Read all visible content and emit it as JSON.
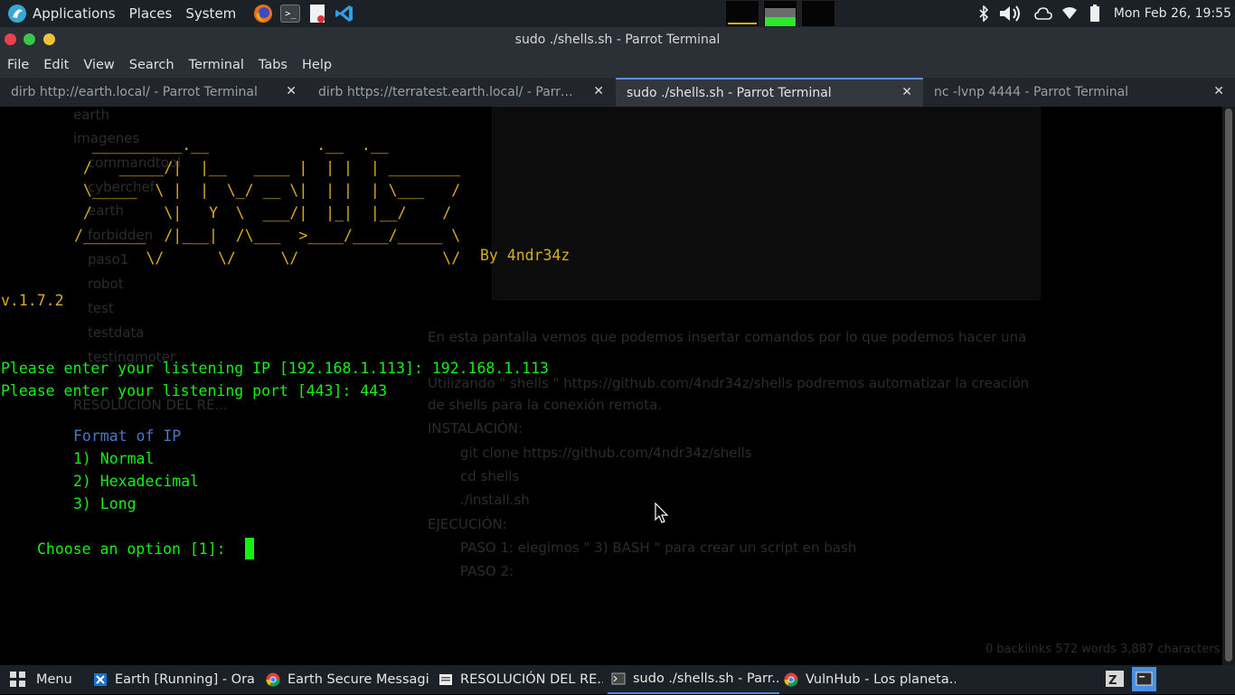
{
  "top_panel": {
    "menus": [
      "Applications",
      "Places",
      "System"
    ],
    "clock": "Mon Feb 26, 19:55",
    "launchers": [
      "firefox-icon",
      "terminal-icon",
      "text-editor-icon",
      "vscode-icon"
    ],
    "tray_icons": [
      "bluetooth-icon",
      "volume-icon",
      "cloud-icon",
      "wifi-icon",
      "battery-icon"
    ]
  },
  "window": {
    "title": "sudo ./shells.sh - Parrot Terminal",
    "menus": [
      "File",
      "Edit",
      "View",
      "Search",
      "Terminal",
      "Tabs",
      "Help"
    ]
  },
  "tabs": [
    {
      "label": "dirb http://earth.local/ - Parrot Terminal",
      "active": false
    },
    {
      "label": "dirb https://terratest.earth.local/ - Parrot Terminal",
      "active": false
    },
    {
      "label": "sudo ./shells.sh - Parrot Terminal",
      "active": true
    },
    {
      "label": "nc -lvnp 4444 - Parrot Terminal",
      "active": false
    }
  ],
  "tab_close_glyph": "✕",
  "terminal": {
    "banner": [
      "  __________.__            .__  .__",
      " /   _____/|  |__   ____ |  | |  | ________",
      " \\_____  \\ |  |  \\_/ __ \\|  | |  | \\___   /",
      " /        \\|   Y  \\  ___/|  |_|  |__/    /",
      "/_______  /|___|  /\\___  >____/____/_____ \\",
      "        \\/      \\/     \\/                \\/  "
    ],
    "byline": "By 4ndr34z",
    "version": "v.1.7.2",
    "ip_prompt": "Please enter your listening IP [192.168.1.113]: 192.168.1.113",
    "port_prompt": "Please enter your listening port [443]: 443",
    "format_header": "Format of IP",
    "options": [
      "1) Normal",
      "2) Hexadecimal",
      "3) Long"
    ],
    "choose_prompt": "Choose an option [1]:"
  },
  "background_text": {
    "sidebar_items": [
      "earth",
      "imagenes",
      "commandtool",
      "cyberchef",
      "earth",
      "forbidden",
      "paso1",
      "robot",
      "test",
      "testdata",
      "testingmoter",
      "RESOLUCIÓN DEL RE..."
    ],
    "doc_lines": [
      "En esta pantalla vemos que podemos insertar comandos por lo que podemos hacer una",
      "…",
      "Utilizando \" shells \" https://github.com/4ndr34z/shells podremos automatizar la creación",
      "de shells para la conexión remota.",
      "INSTALACIÓN:",
      "git clone https://github.com/4ndr34z/shells",
      "cd shells",
      "./install.sh",
      "EJECUCIÓN:",
      "PASO 1: elegimos \" 3) BASH \" para crear un script en bash",
      "PASO 2:"
    ],
    "footer": "0 backlinks   572 words  3,887 characters"
  },
  "taskbar": {
    "menu_label": "Menu",
    "tasks": [
      {
        "label": "Earth [Running] - Ora...",
        "icon": "virtualbox-icon",
        "active": false
      },
      {
        "label": "Earth Secure Messagi...",
        "icon": "chrome-icon",
        "active": false
      },
      {
        "label": "RESOLUCIÓN DEL RE...",
        "icon": "document-icon",
        "active": false
      },
      {
        "label": "sudo ./shells.sh - Parr...",
        "icon": "terminal-icon",
        "active": true
      },
      {
        "label": "VulnHub - Los planeta...",
        "icon": "chrome-icon",
        "active": false
      }
    ]
  },
  "colors": {
    "term_green": "#14f014",
    "term_yellow": "#d7ae1e",
    "term_blue": "#4a78c6",
    "panel": "#1c2027",
    "active_tab_accent": "#5b8fd6"
  }
}
